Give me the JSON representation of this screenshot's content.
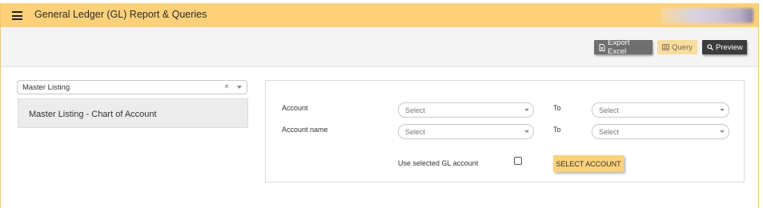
{
  "header": {
    "title": "General Ledger (GL) Report & Queries"
  },
  "toolbar": {
    "export_excel": "Export Excel",
    "query": "Query",
    "preview": "Preview"
  },
  "report": {
    "selected": "Master Listing",
    "items": [
      {
        "label": "Master Listing - Chart of Account"
      }
    ]
  },
  "form": {
    "account_label": "Account",
    "account_name_label": "Account name",
    "to_label": "To",
    "select_placeholder": "Select",
    "use_selected_label": "Use selected GL account",
    "use_selected_checked": false,
    "select_account_button": "SELECT ACCOUNT"
  },
  "colors": {
    "accent": "#fdd17a",
    "excel_button": "#6e6e6e",
    "preview_button": "#3c3c3c",
    "query_button": "#f9dda0"
  }
}
